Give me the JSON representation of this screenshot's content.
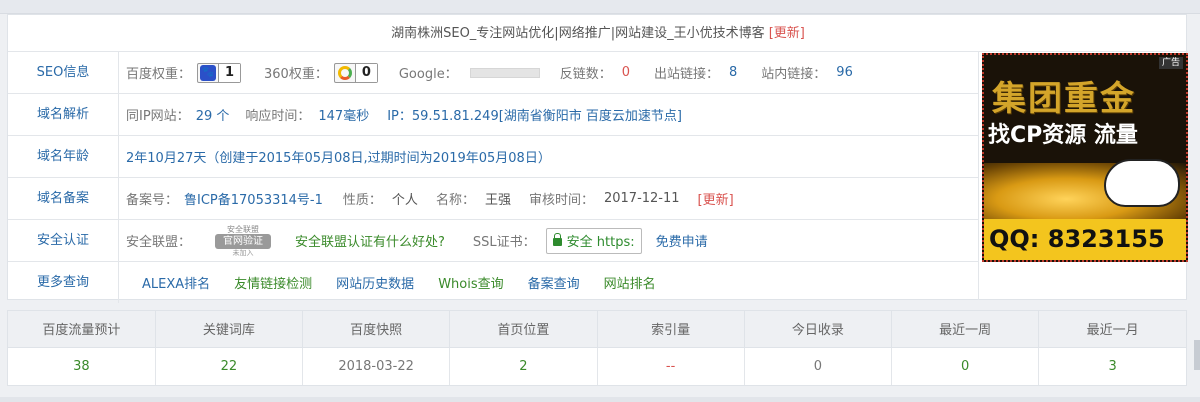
{
  "site_title": {
    "text": "湖南株洲SEO_专注网站优化|网络推广|网站建设_王小优技术博客",
    "update": "[更新]"
  },
  "seo": {
    "label": "SEO信息",
    "baidu_label": "百度权重：",
    "baidu_icon": "baidu-paw-icon",
    "baidu_value": "1",
    "so360_label": "360权重：",
    "so360_icon": "360-ring-icon",
    "so360_value": "0",
    "google_label": "Google：",
    "backlinks_label": "反链数：",
    "backlinks_value": "0",
    "outbound_label": "出站链接：",
    "outbound_value": "8",
    "internal_label": "站内链接：",
    "internal_value": "96"
  },
  "dns": {
    "label": "域名解析",
    "same_ip_label": "同IP网站：",
    "same_ip_value": "29 个",
    "response_label": "响应时间：",
    "response_value": "147毫秒",
    "ip_text": "IP：59.51.81.249[湖南省衡阳市 百度云加速节点]"
  },
  "age": {
    "label": "域名年龄",
    "text": "2年10月27天（创建于2015年05月08日,过期时间为2019年05月08日）"
  },
  "icp": {
    "label": "域名备案",
    "number_label": "备案号：",
    "number_value": "鲁ICP备17053314号-1",
    "nature_label": "性质：",
    "nature_value": "个人",
    "name_label": "名称：",
    "name_value": "王强",
    "audit_label": "审核时间：",
    "audit_value": "2017-12-11",
    "update": "[更新]"
  },
  "security": {
    "label": "安全认证",
    "alliance_label": "安全联盟：",
    "seal_top": "安全联盟",
    "seal_mid": "官网验证",
    "seal_bottom": "未加入",
    "alliance_link": "安全联盟认证有什么好处?",
    "ssl_label": "SSL证书：",
    "ssl_button": "安全 https:",
    "ssl_apply": "免费申请"
  },
  "more": {
    "label": "更多查询",
    "links": [
      "ALEXA排名",
      "友情链接检测",
      "网站历史数据",
      "Whois查询",
      "备案查询",
      "网站排名"
    ]
  },
  "ad": {
    "tag": "广告",
    "headline": "集团重金",
    "subline": "找CP资源 流量",
    "qq": "QQ: 8323155"
  },
  "stats": {
    "headers": [
      "百度流量预计",
      "关键词库",
      "百度快照",
      "首页位置",
      "索引量",
      "今日收录",
      "最近一周",
      "最近一月"
    ],
    "values": [
      "38",
      "22",
      "2018-03-22",
      "2",
      "--",
      "0",
      "0",
      "3"
    ]
  }
}
